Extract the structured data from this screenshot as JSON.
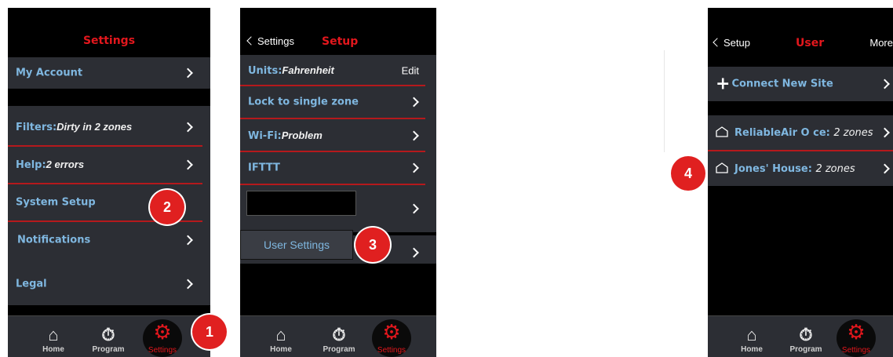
{
  "screen1": {
    "title": "Settings",
    "items": {
      "my_account": "My Account",
      "filters_label": "Filters:",
      "filters_value": "Dirty in 2 zones",
      "help_label": "Help:",
      "help_value": "2 errors",
      "system_setup": "System Setup",
      "notifications": "Notifications",
      "legal": "Legal"
    }
  },
  "screen2": {
    "back": "Settings",
    "title": "Setup",
    "items": {
      "units_label": "Units:",
      "units_value": "Fahrenheit",
      "units_action": "Edit",
      "lock_zone": "Lock to single zone",
      "wifi_label": "Wi-Fi:",
      "wifi_value": "Problem",
      "ifttt": "IFTTT"
    },
    "user_settings": "User Settings"
  },
  "screen3": {
    "back": "Setup",
    "title": "User",
    "more": "More",
    "connect": "Connect New Site",
    "sites": [
      {
        "name": "ReliableAir O ce:",
        "zones": "2 zones"
      },
      {
        "name": "Jones' House:",
        "zones": "2 zones"
      }
    ]
  },
  "tabs": {
    "home": "Home",
    "program": "Program",
    "settings": "Settings"
  },
  "badges": [
    "1",
    "2",
    "3",
    "4"
  ],
  "colors": {
    "accent_red": "#e3171d",
    "row_bg": "#2c2e34",
    "label_blue": "#7fb7e0",
    "badge_red": "#e02020"
  }
}
